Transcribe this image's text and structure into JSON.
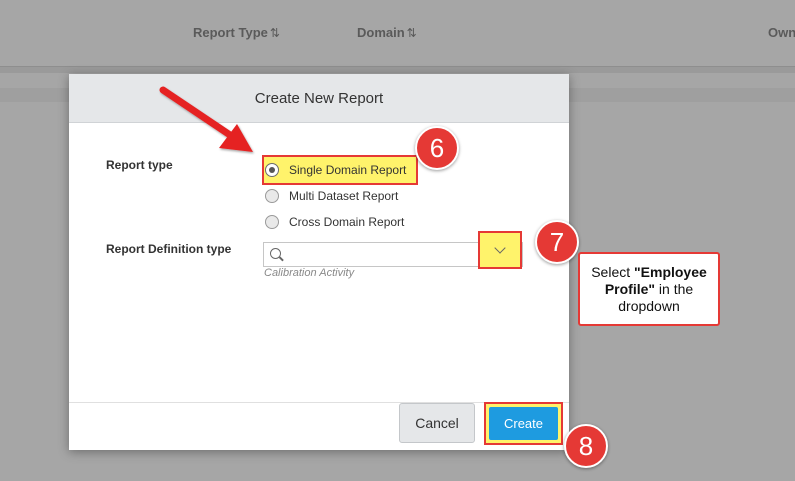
{
  "background_table": {
    "columns": [
      {
        "label": "Report Type",
        "sort": "⇅"
      },
      {
        "label": "Domain",
        "sort": "⇅"
      },
      {
        "label": "Own",
        "sort": ""
      }
    ]
  },
  "dialog": {
    "title": "Create New Report",
    "report_type_label": "Report type",
    "report_type_options": [
      "Single Domain Report",
      "Multi Dataset Report",
      "Cross Domain Report"
    ],
    "report_type_selected": "Single Domain Report",
    "report_definition_label": "Report Definition type",
    "search_placeholder": "",
    "search_value": "",
    "hint_text": "Calibration Activity",
    "cancel_label": "Cancel",
    "create_label": "Create"
  },
  "annotations": {
    "step6": "6",
    "step7": "7",
    "step8": "8",
    "callout_prefix": "Select ",
    "callout_bold": "\"Employee Profile\"",
    "callout_suffix": " in the dropdown",
    "accent_color": "#e53935",
    "highlight_color": "#fff36b"
  }
}
